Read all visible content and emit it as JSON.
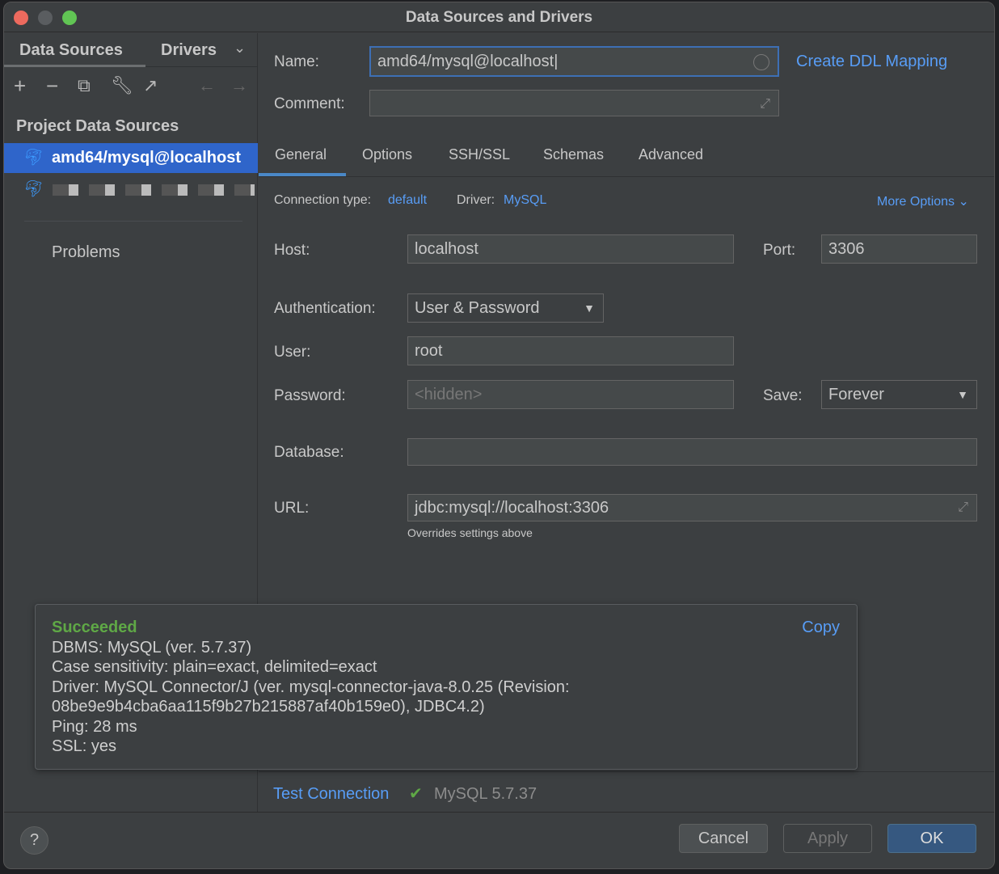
{
  "window": {
    "title": "Data Sources and Drivers"
  },
  "sidebar": {
    "tabs": [
      "Data Sources",
      "Drivers"
    ],
    "section": "Project Data Sources",
    "items": [
      {
        "label": "amd64/mysql@localhost",
        "selected": true
      },
      {
        "label": "",
        "redacted": true
      }
    ],
    "problems": "Problems"
  },
  "form": {
    "name_label": "Name:",
    "name_value": "amd64/mysql@localhost",
    "create_ddl": "Create DDL Mapping",
    "comment_label": "Comment:",
    "comment_value": "",
    "tabs": [
      "General",
      "Options",
      "SSH/SSL",
      "Schemas",
      "Advanced"
    ],
    "active_tab": "General",
    "conn_type_label": "Connection type:",
    "conn_type_value": "default",
    "driver_label": "Driver:",
    "driver_value": "MySQL",
    "more_options": "More Options",
    "host_label": "Host:",
    "host_value": "localhost",
    "port_label": "Port:",
    "port_value": "3306",
    "auth_label": "Authentication:",
    "auth_value": "User & Password",
    "user_label": "User:",
    "user_value": "root",
    "password_label": "Password:",
    "password_placeholder": "<hidden>",
    "save_label": "Save:",
    "save_value": "Forever",
    "database_label": "Database:",
    "database_value": "",
    "url_label": "URL:",
    "url_value": "jdbc:mysql://localhost:3306",
    "url_hint": "Overrides settings above"
  },
  "popup": {
    "status": "Succeeded",
    "copy": "Copy",
    "lines": [
      "DBMS: MySQL (ver. 5.7.37)",
      "Case sensitivity: plain=exact, delimited=exact",
      "Driver: MySQL Connector/J (ver. mysql-connector-java-8.0.25 (Revision:",
      "08be9e9b4cba6aa115f9b27b215887af40b159e0), JDBC4.2)",
      "Ping: 28 ms",
      "SSL: yes"
    ]
  },
  "test": {
    "label": "Test Connection",
    "result": "MySQL 5.7.37"
  },
  "buttons": {
    "help": "?",
    "cancel": "Cancel",
    "apply": "Apply",
    "ok": "OK"
  },
  "colors": {
    "accent": "#589df6",
    "selection": "#2f65ca",
    "success": "#5fa846"
  }
}
